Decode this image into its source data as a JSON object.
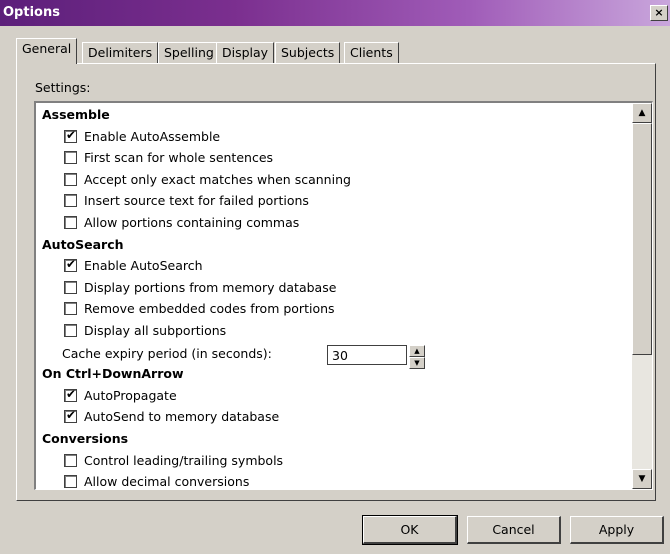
{
  "window": {
    "title": "Options",
    "close_label": "×"
  },
  "tabs": [
    "General",
    "Delimiters",
    "Spelling",
    "Display",
    "Subjects",
    "Clients"
  ],
  "settings_label": "Settings:",
  "sections": [
    {
      "title": "Assemble",
      "items": [
        {
          "label": "Enable AutoAssemble",
          "checked": true
        },
        {
          "label": "First scan for whole sentences",
          "checked": false
        },
        {
          "label": "Accept only exact matches when scanning",
          "checked": false
        },
        {
          "label": "Insert source text for failed portions",
          "checked": false
        },
        {
          "label": "Allow portions containing commas",
          "checked": false
        }
      ]
    },
    {
      "title": "AutoSearch",
      "items": [
        {
          "label": "Enable AutoSearch",
          "checked": true
        },
        {
          "label": "Display portions from memory database",
          "checked": false
        },
        {
          "label": "Remove embedded codes from portions",
          "checked": false
        },
        {
          "label": "Display all subportions",
          "checked": false
        }
      ]
    },
    {
      "title": "On Ctrl+DownArrow",
      "items": [
        {
          "label": "AutoPropagate",
          "checked": true
        },
        {
          "label": "AutoSend to memory database",
          "checked": true
        }
      ]
    },
    {
      "title": "Conversions",
      "items": [
        {
          "label": "Control leading/trailing symbols",
          "checked": false
        },
        {
          "label": "Allow decimal conversions",
          "checked": false
        }
      ]
    }
  ],
  "cache": {
    "label": "Cache expiry period (in seconds):",
    "value": "30"
  },
  "buttons": {
    "ok": "OK",
    "cancel": "Cancel",
    "apply": "Apply"
  },
  "icons": {
    "checkmark": "✔",
    "scroll_up": "▲",
    "scroll_down": "▼",
    "spin_up": "▲",
    "spin_down": "▼"
  }
}
